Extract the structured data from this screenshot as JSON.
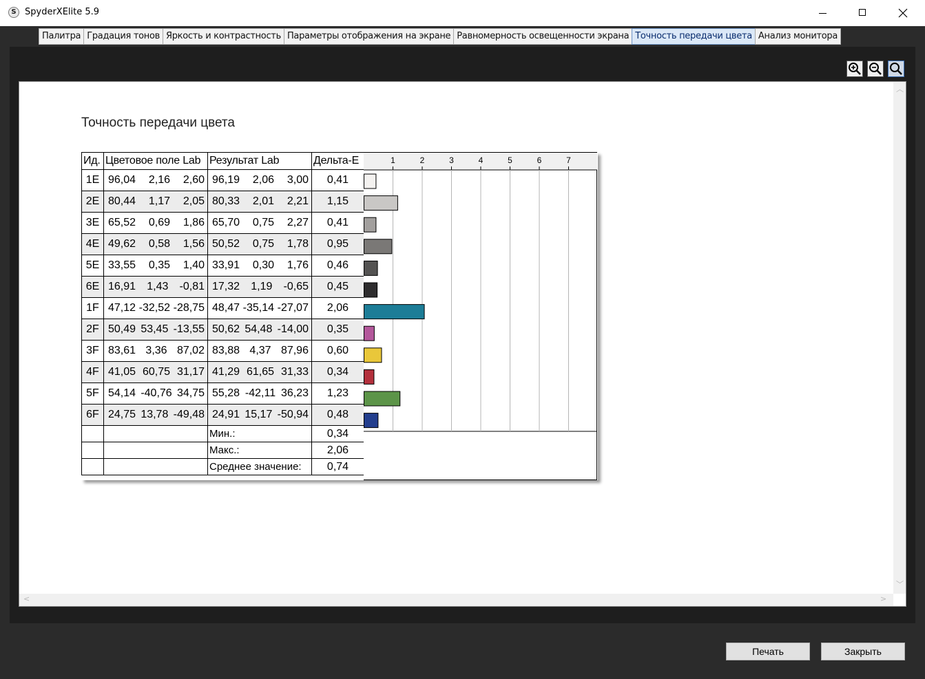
{
  "window": {
    "title": "SpyderXElite 5.9",
    "app_icon_letter": "S"
  },
  "tabs": [
    {
      "label": "Палитра",
      "active": false
    },
    {
      "label": "Градация тонов",
      "active": false
    },
    {
      "label": "Яркость и контрастность",
      "active": false
    },
    {
      "label": "Параметры отображения на экране",
      "active": false
    },
    {
      "label": "Равномерность освещенности экрана",
      "active": false
    },
    {
      "label": "Точность передачи цвета",
      "active": true
    },
    {
      "label": "Анализ монитора",
      "active": false
    }
  ],
  "zoom_buttons": [
    {
      "name": "zoom-in-icon"
    },
    {
      "name": "zoom-out-icon"
    },
    {
      "name": "zoom-fit-icon",
      "active": true
    }
  ],
  "report": {
    "title": "Точность передачи цвета",
    "columns": [
      "Ид.",
      "Цветовое поле Lab",
      "Результат Lab",
      "Дельта-E"
    ],
    "rows": [
      {
        "id": "1E",
        "target": [
          "96,04",
          "2,16",
          "2,60"
        ],
        "result": [
          "96,19",
          "2,06",
          "3,00"
        ],
        "delta": "0,41",
        "color": "#f4f2f0"
      },
      {
        "id": "2E",
        "target": [
          "80,44",
          "1,17",
          "2,05"
        ],
        "result": [
          "80,33",
          "2,01",
          "2,21"
        ],
        "delta": "1,15",
        "color": "#c9c7c5"
      },
      {
        "id": "3E",
        "target": [
          "65,52",
          "0,69",
          "1,86"
        ],
        "result": [
          "65,70",
          "0,75",
          "2,27"
        ],
        "delta": "0,41",
        "color": "#a29f9d"
      },
      {
        "id": "4E",
        "target": [
          "49,62",
          "0,58",
          "1,56"
        ],
        "result": [
          "50,52",
          "0,75",
          "1,78"
        ],
        "delta": "0,95",
        "color": "#7a7876"
      },
      {
        "id": "5E",
        "target": [
          "33,55",
          "0,35",
          "1,40"
        ],
        "result": [
          "33,91",
          "0,30",
          "1,76"
        ],
        "delta": "0,46",
        "color": "#545352"
      },
      {
        "id": "6E",
        "target": [
          "16,91",
          "1,43",
          "-0,81"
        ],
        "result": [
          "17,32",
          "1,19",
          "-0,65"
        ],
        "delta": "0,45",
        "color": "#2e2d2e"
      },
      {
        "id": "1F",
        "target": [
          "47,12",
          "-32,52",
          "-28,75"
        ],
        "result": [
          "48,47",
          "-35,14",
          "-27,07"
        ],
        "delta": "2,06",
        "color": "#1d7d97"
      },
      {
        "id": "2F",
        "target": [
          "50,49",
          "53,45",
          "-13,55"
        ],
        "result": [
          "50,62",
          "54,48",
          "-14,00"
        ],
        "delta": "0,35",
        "color": "#b3579b"
      },
      {
        "id": "3F",
        "target": [
          "83,61",
          "3,36",
          "87,02"
        ],
        "result": [
          "83,88",
          "4,37",
          "87,96"
        ],
        "delta": "0,60",
        "color": "#e9c73a"
      },
      {
        "id": "4F",
        "target": [
          "41,05",
          "60,75",
          "31,17"
        ],
        "result": [
          "41,29",
          "61,65",
          "31,33"
        ],
        "delta": "0,34",
        "color": "#b3303c"
      },
      {
        "id": "5F",
        "target": [
          "54,14",
          "-40,76",
          "34,75"
        ],
        "result": [
          "55,28",
          "-42,11",
          "36,23"
        ],
        "delta": "1,23",
        "color": "#5c9448"
      },
      {
        "id": "6F",
        "target": [
          "24,75",
          "13,78",
          "-49,48"
        ],
        "result": [
          "24,91",
          "15,17",
          "-50,94"
        ],
        "delta": "0,48",
        "color": "#233e8d"
      }
    ],
    "summary": [
      {
        "label": "Мин.:",
        "value": "0,34"
      },
      {
        "label": "Макс.:",
        "value": "2,06"
      },
      {
        "label": "Среднее значение:",
        "value": "0,74"
      }
    ]
  },
  "chart_data": {
    "type": "bar",
    "orientation": "horizontal",
    "categories": [
      "1E",
      "2E",
      "3E",
      "4E",
      "5E",
      "6E",
      "1F",
      "2F",
      "3F",
      "4F",
      "5F",
      "6F"
    ],
    "values": [
      0.41,
      1.15,
      0.41,
      0.95,
      0.46,
      0.45,
      2.06,
      0.35,
      0.6,
      0.34,
      1.23,
      0.48
    ],
    "colors": [
      "#f4f2f0",
      "#c9c7c5",
      "#a29f9d",
      "#7a7876",
      "#545352",
      "#2e2d2e",
      "#1d7d97",
      "#b3579b",
      "#e9c73a",
      "#b3303c",
      "#5c9448",
      "#233e8d"
    ],
    "x_ticks": [
      "1",
      "2",
      "3",
      "4",
      "5",
      "6",
      "7"
    ],
    "xlim": [
      0,
      8
    ],
    "grid": true
  },
  "footer": {
    "print_label": "Печать",
    "close_label": "Закрыть"
  }
}
